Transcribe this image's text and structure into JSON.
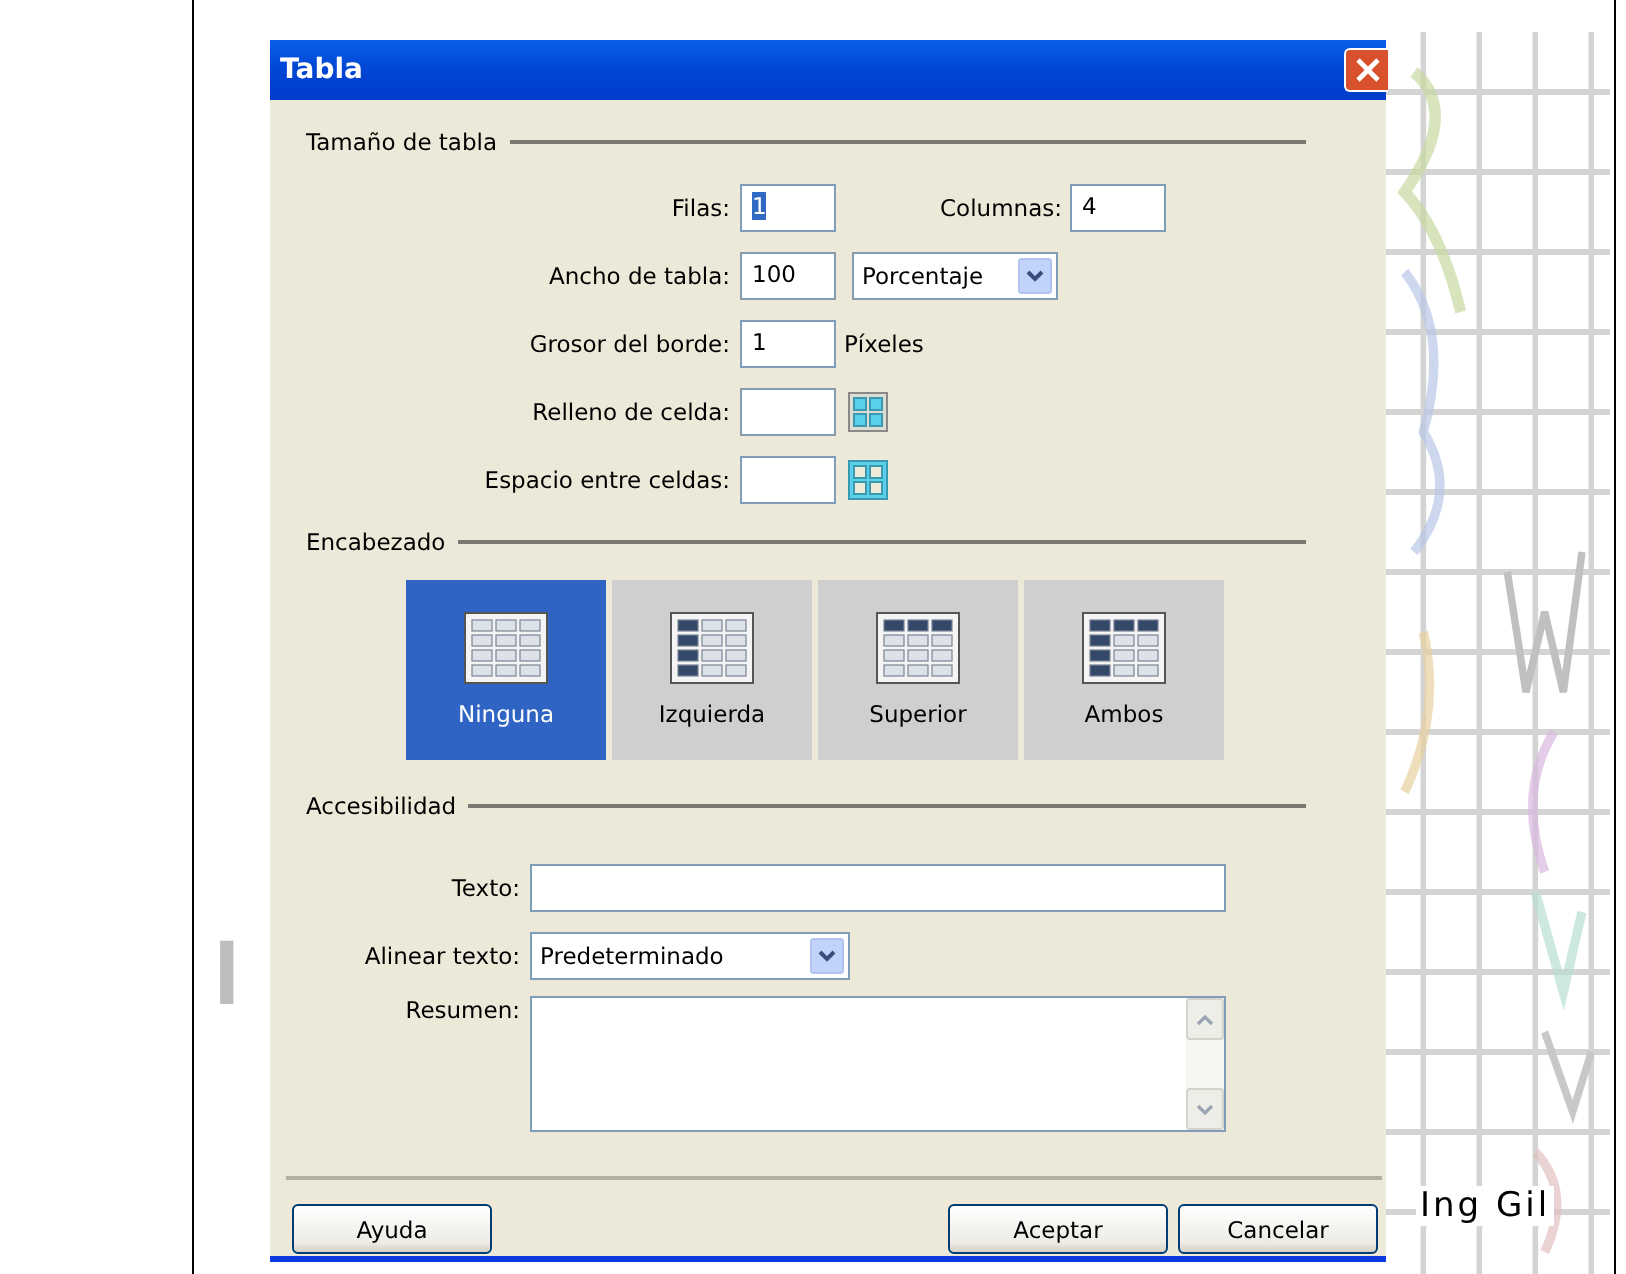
{
  "background_heading": "I",
  "footer_text": "Ing Gil",
  "window": {
    "title": "Tabla"
  },
  "size_section": {
    "title": "Tamaño de tabla",
    "rows": {
      "label": "Filas:",
      "value": "1",
      "text_selected": true
    },
    "columns": {
      "label": "Columnas:",
      "value": "4"
    },
    "width": {
      "label": "Ancho de tabla:",
      "value": "100",
      "unit": "Porcentaje"
    },
    "border": {
      "label": "Grosor del borde:",
      "value": "1",
      "unit": "Píxeles"
    },
    "padding": {
      "label": "Relleno de celda:"
    },
    "spacing": {
      "label": "Espacio entre celdas:"
    }
  },
  "header_section": {
    "title": "Encabezado",
    "options": [
      {
        "label": "Ninguna",
        "kind": "none",
        "selected": true
      },
      {
        "label": "Izquierda",
        "kind": "left",
        "selected": false
      },
      {
        "label": "Superior",
        "kind": "top",
        "selected": false
      },
      {
        "label": "Ambos",
        "kind": "both",
        "selected": false
      }
    ]
  },
  "accessibility_section": {
    "title": "Accesibilidad",
    "caption": {
      "label": "Texto:"
    },
    "align": {
      "label": "Alinear texto:",
      "value": "Predeterminado"
    },
    "summary": {
      "label": "Resumen:"
    }
  },
  "buttons": [
    {
      "label": "Ayuda"
    },
    {
      "label": "Aceptar"
    },
    {
      "label": "Cancelar"
    }
  ]
}
